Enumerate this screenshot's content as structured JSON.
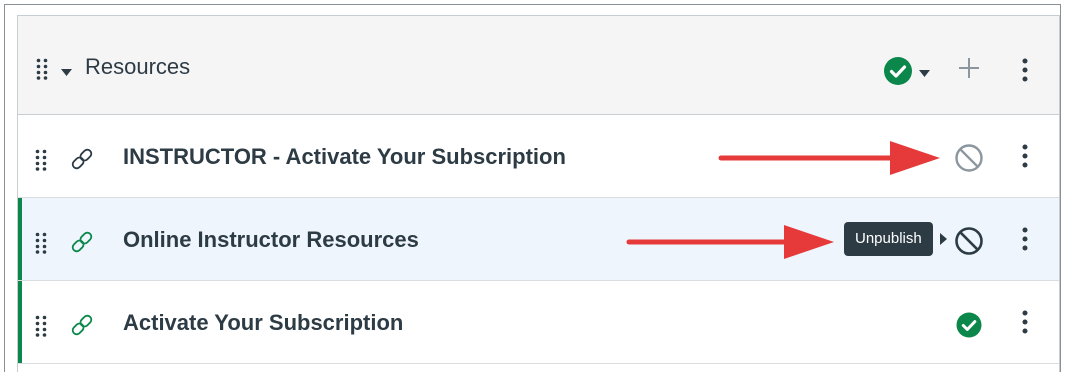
{
  "module": {
    "title": "Resources",
    "status_icon": "check-circle-icon",
    "add_icon": "plus-icon",
    "menu_icon": "kebab-icon"
  },
  "items": [
    {
      "title": "INSTRUCTOR - Activate Your Subscription",
      "type_icon": "link-icon",
      "status": "unpublished",
      "status_icon": "unpublished-icon"
    },
    {
      "title": "Online Instructor Resources",
      "type_icon": "link-icon",
      "status": "published",
      "status_icon": "unpublished-icon"
    },
    {
      "title": "Activate Your Subscription",
      "type_icon": "link-icon",
      "status": "published",
      "status_icon": "check-circle-icon"
    }
  ],
  "tooltip": {
    "text": "Unpublish"
  },
  "colors": {
    "published_green": "#0b874b",
    "annotation_red": "#e63a3a",
    "header_bg": "#f5f5f5",
    "hover_row_bg": "#eef5fc",
    "text": "#2d3b45"
  }
}
